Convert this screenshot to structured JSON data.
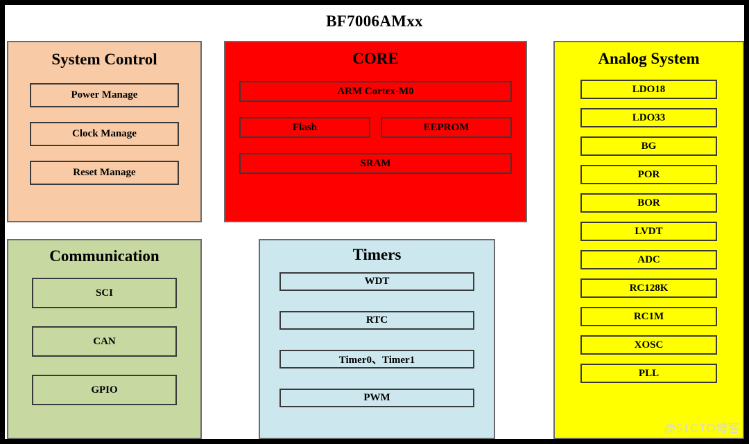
{
  "diagram": {
    "title": "BF7006AMxx",
    "watermark": "@51CTO博客",
    "colors": {
      "system_control_bg": "#F8CBA6",
      "core_bg": "#FF0000",
      "analog_bg": "#FFFF00",
      "communication_bg": "#C7D8A0",
      "timers_bg": "#CDE7EE",
      "frame": "#000000",
      "box_border": "#3A3A3A",
      "watermark_text": "#D8D8D8"
    },
    "blocks": {
      "system_control": {
        "title": "System Control",
        "items": [
          {
            "label": "Power Manage"
          },
          {
            "label": "Clock Manage"
          },
          {
            "label": "Reset Manage"
          }
        ]
      },
      "core": {
        "title": "CORE",
        "items": [
          {
            "label": "ARM Cortex-M0"
          },
          {
            "label": "Flash"
          },
          {
            "label": "EEPROM"
          },
          {
            "label": "SRAM"
          }
        ]
      },
      "analog_system": {
        "title": "Analog System",
        "items": [
          {
            "label": "LDO18"
          },
          {
            "label": "LDO33"
          },
          {
            "label": "BG"
          },
          {
            "label": "POR"
          },
          {
            "label": "BOR"
          },
          {
            "label": "LVDT"
          },
          {
            "label": "ADC"
          },
          {
            "label": "RC128K"
          },
          {
            "label": "RC1M"
          },
          {
            "label": "XOSC"
          },
          {
            "label": "PLL"
          }
        ]
      },
      "communication": {
        "title": "Communication",
        "items": [
          {
            "label": "SCI"
          },
          {
            "label": "CAN"
          },
          {
            "label": "GPIO"
          }
        ]
      },
      "timers": {
        "title": "Timers",
        "items": [
          {
            "label": "WDT"
          },
          {
            "label": "RTC"
          },
          {
            "label": "Timer0、Timer1"
          },
          {
            "label": "PWM"
          }
        ]
      }
    }
  }
}
